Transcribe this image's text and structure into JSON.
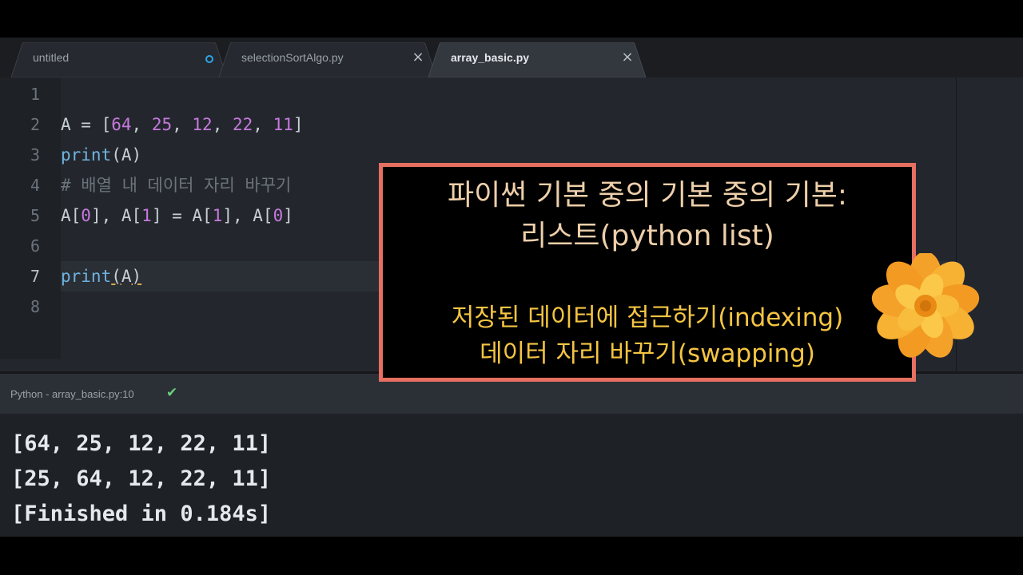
{
  "tabs": [
    {
      "label": "untitled",
      "state": "unsaved"
    },
    {
      "label": "selectionSortAlgo.py",
      "close": "×"
    },
    {
      "label": "array_basic.py",
      "close": "×",
      "active": true
    }
  ],
  "editor": {
    "line_numbers": [
      "1",
      "2",
      "3",
      "4",
      "5",
      "6",
      "7",
      "8"
    ],
    "current_line": "7",
    "code": {
      "l2": {
        "a": "A = [",
        "n1": "64",
        "s1": ", ",
        "n2": "25",
        "s2": ", ",
        "n3": "12",
        "s3": ", ",
        "n4": "22",
        "s4": ", ",
        "n5": "11",
        "e": "]"
      },
      "l3": {
        "fn": "print",
        "args": "(A)"
      },
      "l4": {
        "comment": "# 배열 내 데이터 자리 바꾸기"
      },
      "l5": {
        "a": "A[",
        "n1": "0",
        "b": "], A[",
        "n2": "1",
        "c": "] = A[",
        "n3": "1",
        "d": "], A[",
        "n4": "0",
        "e": "]"
      },
      "l7": {
        "fn": "print",
        "p1": "(",
        "arg": "A",
        "p2": ")"
      }
    }
  },
  "status": {
    "text": "Python - array_basic.py:10",
    "icon": "check-icon"
  },
  "output": {
    "lines": [
      "[64, 25, 12, 22, 11]",
      "[25, 64, 12, 22, 11]",
      "[Finished in 0.184s]"
    ]
  },
  "caption": {
    "title_line1": "파이썬 기본 중의 기본 중의 기본:",
    "title_line2": "리스트(python list)",
    "sub_line1": "저장된 데이터에 접근하기(indexing)",
    "sub_line2": "데이터 자리 바꾸기(swapping)"
  },
  "colors": {
    "accent_border": "#e56f61",
    "caption_title": "#eecfaa",
    "caption_sub": "#f5c542",
    "number": "#c679dd",
    "function": "#6fb3e0"
  }
}
